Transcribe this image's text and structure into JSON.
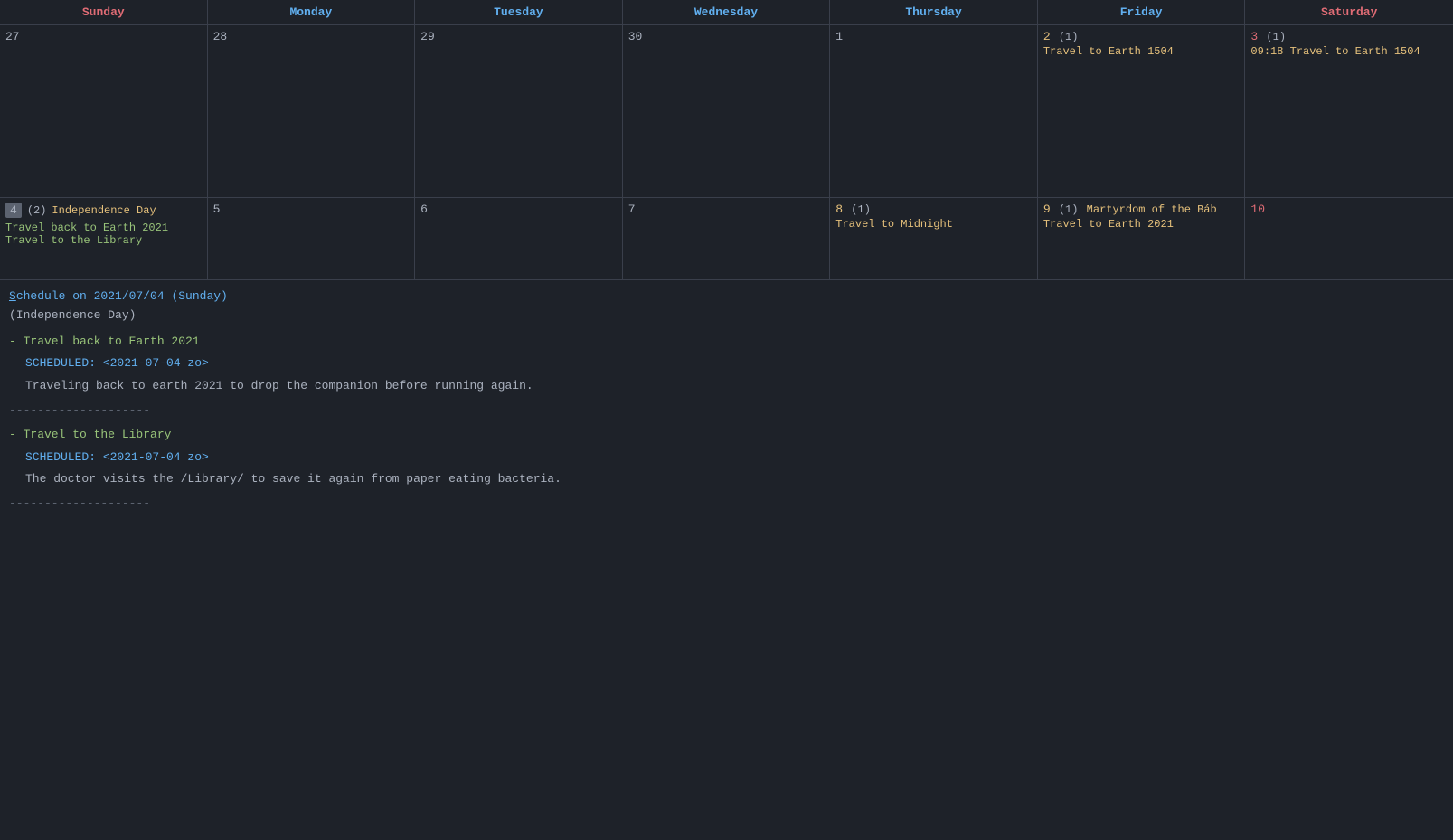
{
  "calendar": {
    "headers": [
      {
        "label": "Sunday",
        "class": "col-sun"
      },
      {
        "label": "Monday",
        "class": "col-mon"
      },
      {
        "label": "Tuesday",
        "class": "col-tue"
      },
      {
        "label": "Wednesday",
        "class": "col-wed"
      },
      {
        "label": "Thursday",
        "class": "col-thu"
      },
      {
        "label": "Friday",
        "class": "col-fri"
      },
      {
        "label": "Saturday",
        "class": "col-sat"
      }
    ],
    "rows": [
      {
        "short": false,
        "cells": [
          {
            "day": "27",
            "dayClass": "normal",
            "events": []
          },
          {
            "day": "28",
            "dayClass": "normal",
            "events": []
          },
          {
            "day": "29",
            "dayClass": "normal",
            "events": []
          },
          {
            "day": "30",
            "dayClass": "normal",
            "events": []
          },
          {
            "day": "1",
            "dayClass": "normal",
            "events": []
          },
          {
            "day": "2",
            "dayClass": "orange",
            "count": "(1)",
            "events": [
              {
                "text": "Travel to Earth 1504",
                "class": "event-orange"
              }
            ]
          },
          {
            "day": "3",
            "dayClass": "red",
            "count": "(1)",
            "events": [
              {
                "text": "09:18 Travel to Earth 1504",
                "class": "event-orange"
              }
            ]
          }
        ]
      },
      {
        "short": true,
        "cells": [
          {
            "day": "4",
            "dayClass": "today",
            "count": "(2)",
            "holiday": "Independence Day",
            "events": [
              {
                "text": "Travel back to Earth 2021",
                "class": "event-green"
              },
              {
                "text": "Travel to the Library",
                "class": "event-green"
              }
            ]
          },
          {
            "day": "5",
            "dayClass": "normal",
            "events": []
          },
          {
            "day": "6",
            "dayClass": "normal",
            "events": []
          },
          {
            "day": "7",
            "dayClass": "normal",
            "events": []
          },
          {
            "day": "8",
            "dayClass": "orange",
            "count": "(1)",
            "events": [
              {
                "text": "Travel to Midnight",
                "class": "event-orange"
              }
            ]
          },
          {
            "day": "9",
            "dayClass": "orange",
            "count": "(1)",
            "holiday": "Martyrdom of the Báb",
            "events": [
              {
                "text": "Travel to Earth 2021",
                "class": "event-orange"
              }
            ]
          },
          {
            "day": "10",
            "dayClass": "red",
            "events": []
          }
        ]
      }
    ]
  },
  "schedule": {
    "title_underline": "S",
    "title_rest": "chedule on 2021/07/04 (Sunday)",
    "holiday": "(Independence Day)",
    "entries": [
      {
        "title": "- Travel back to Earth 2021",
        "scheduled": "SCHEDULED: <2021-07-04 zo>",
        "description": "Traveling back to earth 2021 to drop the companion before running again."
      },
      {
        "title": "- Travel to the Library",
        "scheduled": "SCHEDULED: <2021-07-04 zo>",
        "description": "The doctor visits the /Library/ to save it again from paper eating bacteria."
      }
    ],
    "divider": "--------------------"
  }
}
